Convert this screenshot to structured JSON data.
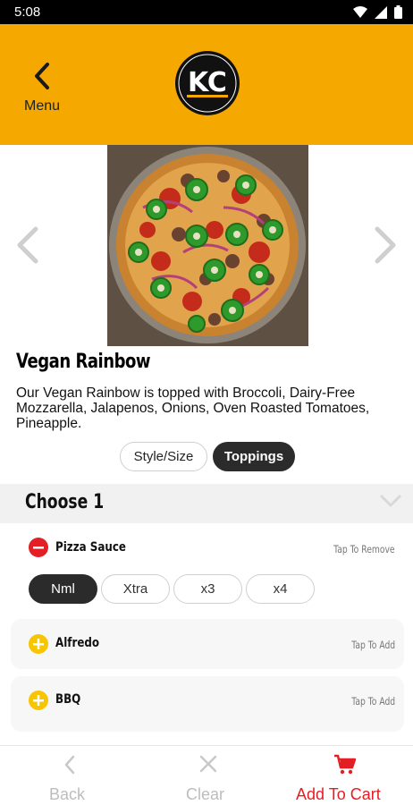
{
  "status_bar": {
    "time": "5:08"
  },
  "header": {
    "back_label": "Menu",
    "logo_text": "KC",
    "brand_color": "#F5A800"
  },
  "product": {
    "title": "Vegan Rainbow",
    "description": "Our Vegan Rainbow is topped with Broccoli, Dairy-Free Mozzarella, Jalapenos, Onions, Oven Roasted Tomatoes, Pineapple."
  },
  "tabs": [
    {
      "label": "Style/Size",
      "selected": false
    },
    {
      "label": "Toppings",
      "selected": true
    }
  ],
  "section": {
    "title": "Choose 1"
  },
  "options": [
    {
      "name": "Pizza Sauce",
      "hint": "Tap To Remove",
      "state": "selected",
      "icon": "minus-circle-icon"
    },
    {
      "name": "Alfredo",
      "hint": "Tap To Add",
      "state": "unselected",
      "icon": "plus-circle-icon"
    },
    {
      "name": "BBQ",
      "hint": "Tap To Add",
      "state": "unselected",
      "icon": "plus-circle-icon"
    }
  ],
  "amounts": [
    {
      "label": "Nml",
      "selected": true
    },
    {
      "label": "Xtra",
      "selected": false
    },
    {
      "label": "x3",
      "selected": false
    },
    {
      "label": "x4",
      "selected": false
    }
  ],
  "bottom_nav": {
    "back": "Back",
    "clear": "Clear",
    "add_to_cart": "Add To Cart",
    "accent_color": "#e31e24"
  }
}
